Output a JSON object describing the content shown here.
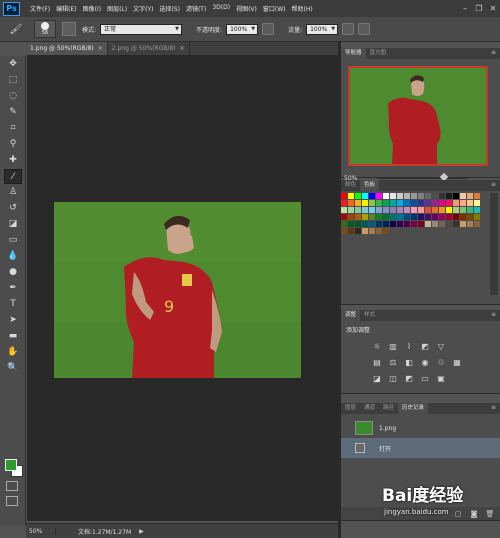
{
  "app": {
    "logo": "Ps"
  },
  "menu": [
    "文件(F)",
    "编辑(E)",
    "图像(I)",
    "图层(L)",
    "文字(Y)",
    "选择(S)",
    "滤镜(T)",
    "3D(D)",
    "视图(V)",
    "窗口(W)",
    "帮助(H)"
  ],
  "window_controls": {
    "minimize": "–",
    "restore": "❐",
    "close": "✕"
  },
  "options": {
    "brush_size": "56",
    "mode_label": "模式:",
    "mode_value": "正常",
    "opacity_label": "不透明度:",
    "opacity_value": "100%",
    "flow_label": "流量:",
    "flow_value": "100%"
  },
  "doc_tabs": [
    {
      "label": "1.png @ 50%(RGB/8)",
      "close": "×",
      "active": true
    },
    {
      "label": "2.png @ 50%(RGB/8)",
      "close": "×",
      "active": false
    }
  ],
  "status": {
    "zoom": "50%",
    "doc": "文档:1.27M/1.27M",
    "arrow": "▶"
  },
  "navigator": {
    "tabs": [
      "导航器",
      "直方图"
    ],
    "zoom": "50%"
  },
  "swatches": {
    "tabs": [
      "颜色",
      "色板"
    ]
  },
  "adjustments": {
    "tabs": [
      "调整",
      "样式"
    ],
    "title": "添加调整"
  },
  "history": {
    "tabs": [
      "图层",
      "通道",
      "路径",
      "历史记录"
    ],
    "items": [
      {
        "label": "1.png",
        "selected": false
      },
      {
        "label": "打开",
        "selected": true
      }
    ]
  },
  "watermark": {
    "brand": "Bai度经验",
    "url": "jingyan.baidu.com"
  },
  "colors": {
    "fg": "#2e9a2e",
    "bg": "#ffffff",
    "accent": "#c53a2a",
    "selection": "#5e6b7b"
  }
}
